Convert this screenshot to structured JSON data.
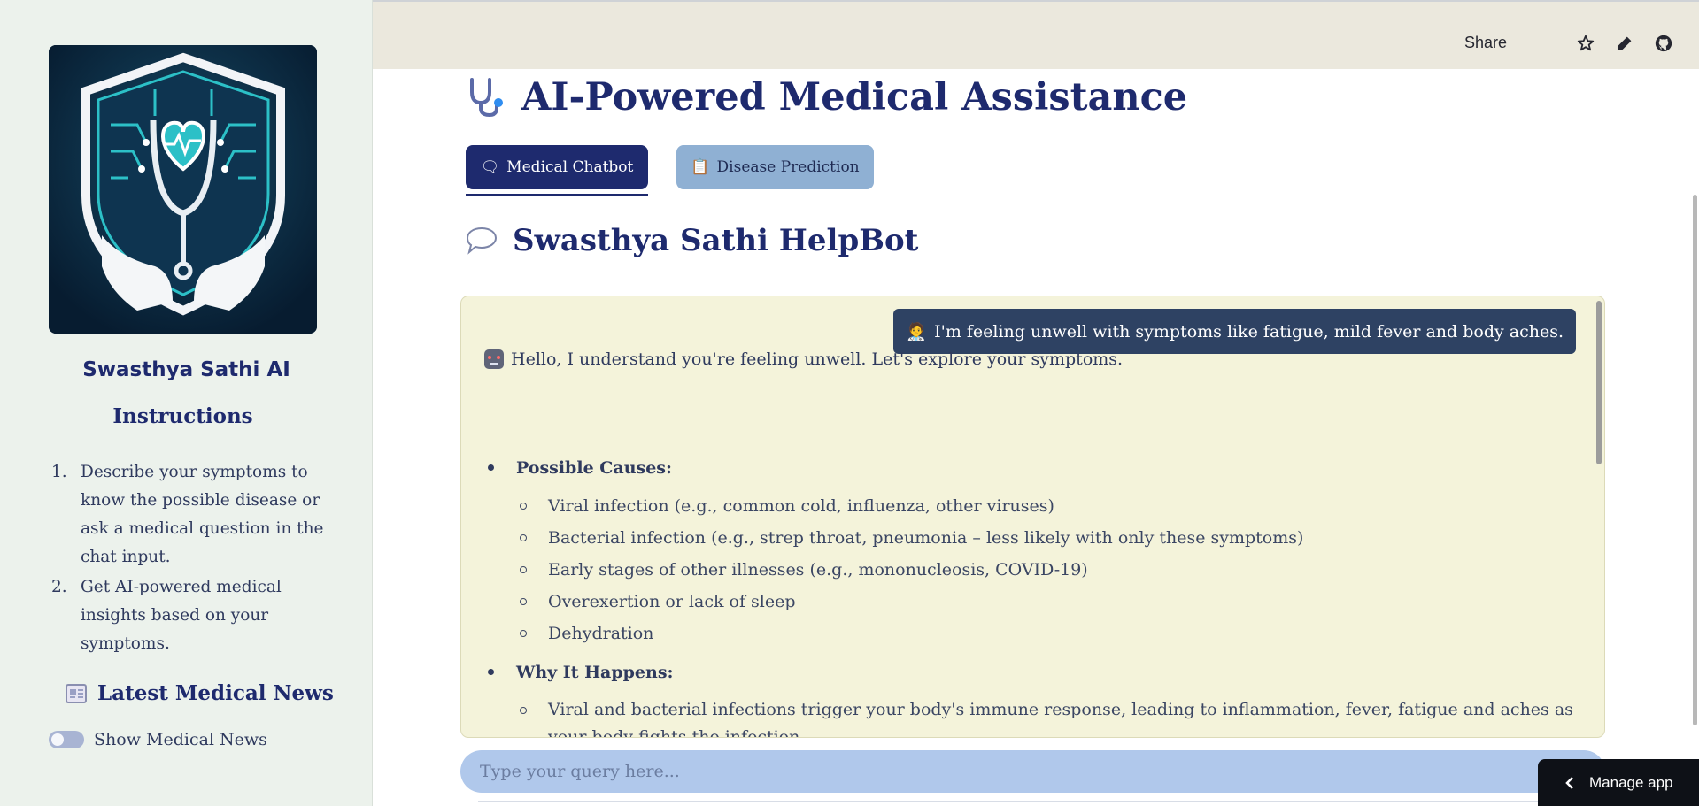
{
  "sidebar": {
    "brand": "Swasthya Sathi AI",
    "instructions_title": "Instructions",
    "instructions": [
      {
        "num": "1.",
        "text": "Describe your symptoms to know the possible disease or ask a medical question in the chat input."
      },
      {
        "num": "2.",
        "text": "Get AI-powered medical insights based on your symptoms."
      }
    ],
    "news_title": "Latest Medical News",
    "toggle_label": "Show Medical News",
    "toggle_on": false
  },
  "header": {
    "share": "Share",
    "icons": [
      "star-icon",
      "edit-icon",
      "github-icon",
      "more-vertical-icon"
    ]
  },
  "main": {
    "title": "AI-Powered Medical Assistance",
    "tabs": [
      {
        "label": "Medical Chatbot",
        "icon": "speech-bubble-icon",
        "active": true
      },
      {
        "label": "Disease Prediction",
        "icon": "clipboard-icon",
        "active": false
      }
    ],
    "section_title": "Swasthya Sathi HelpBot"
  },
  "chat": {
    "user_message": "I'm feeling unwell with symptoms like fatigue, mild fever and body aches.",
    "bot_intro": "Hello, I understand you're feeling unwell. Let's explore your symptoms.",
    "sections": [
      {
        "heading": "Possible Causes:",
        "items": [
          "Viral infection (e.g., common cold, influenza, other viruses)",
          "Bacterial infection (e.g., strep throat, pneumonia – less likely with only these symptoms)",
          "Early stages of other illnesses (e.g., mononucleosis, COVID-19)",
          "Overexertion or lack of sleep",
          "Dehydration"
        ]
      },
      {
        "heading": "Why It Happens:",
        "items": [
          "Viral and bacterial infections trigger your body's immune response, leading to inflammation, fever, fatigue and aches as your body fights the infection."
        ]
      }
    ],
    "input_placeholder": "Type your query here..."
  },
  "manage_app": "Manage app",
  "colors": {
    "primary": "#1e2a6e",
    "sidebar_bg": "#ecf2ec",
    "header_bg": "#ebe8dd",
    "chat_bg": "#f4f3da",
    "user_bubble": "#2e4263",
    "input_bg": "#b0c8eb",
    "tab_inactive": "#8fb0d3"
  }
}
